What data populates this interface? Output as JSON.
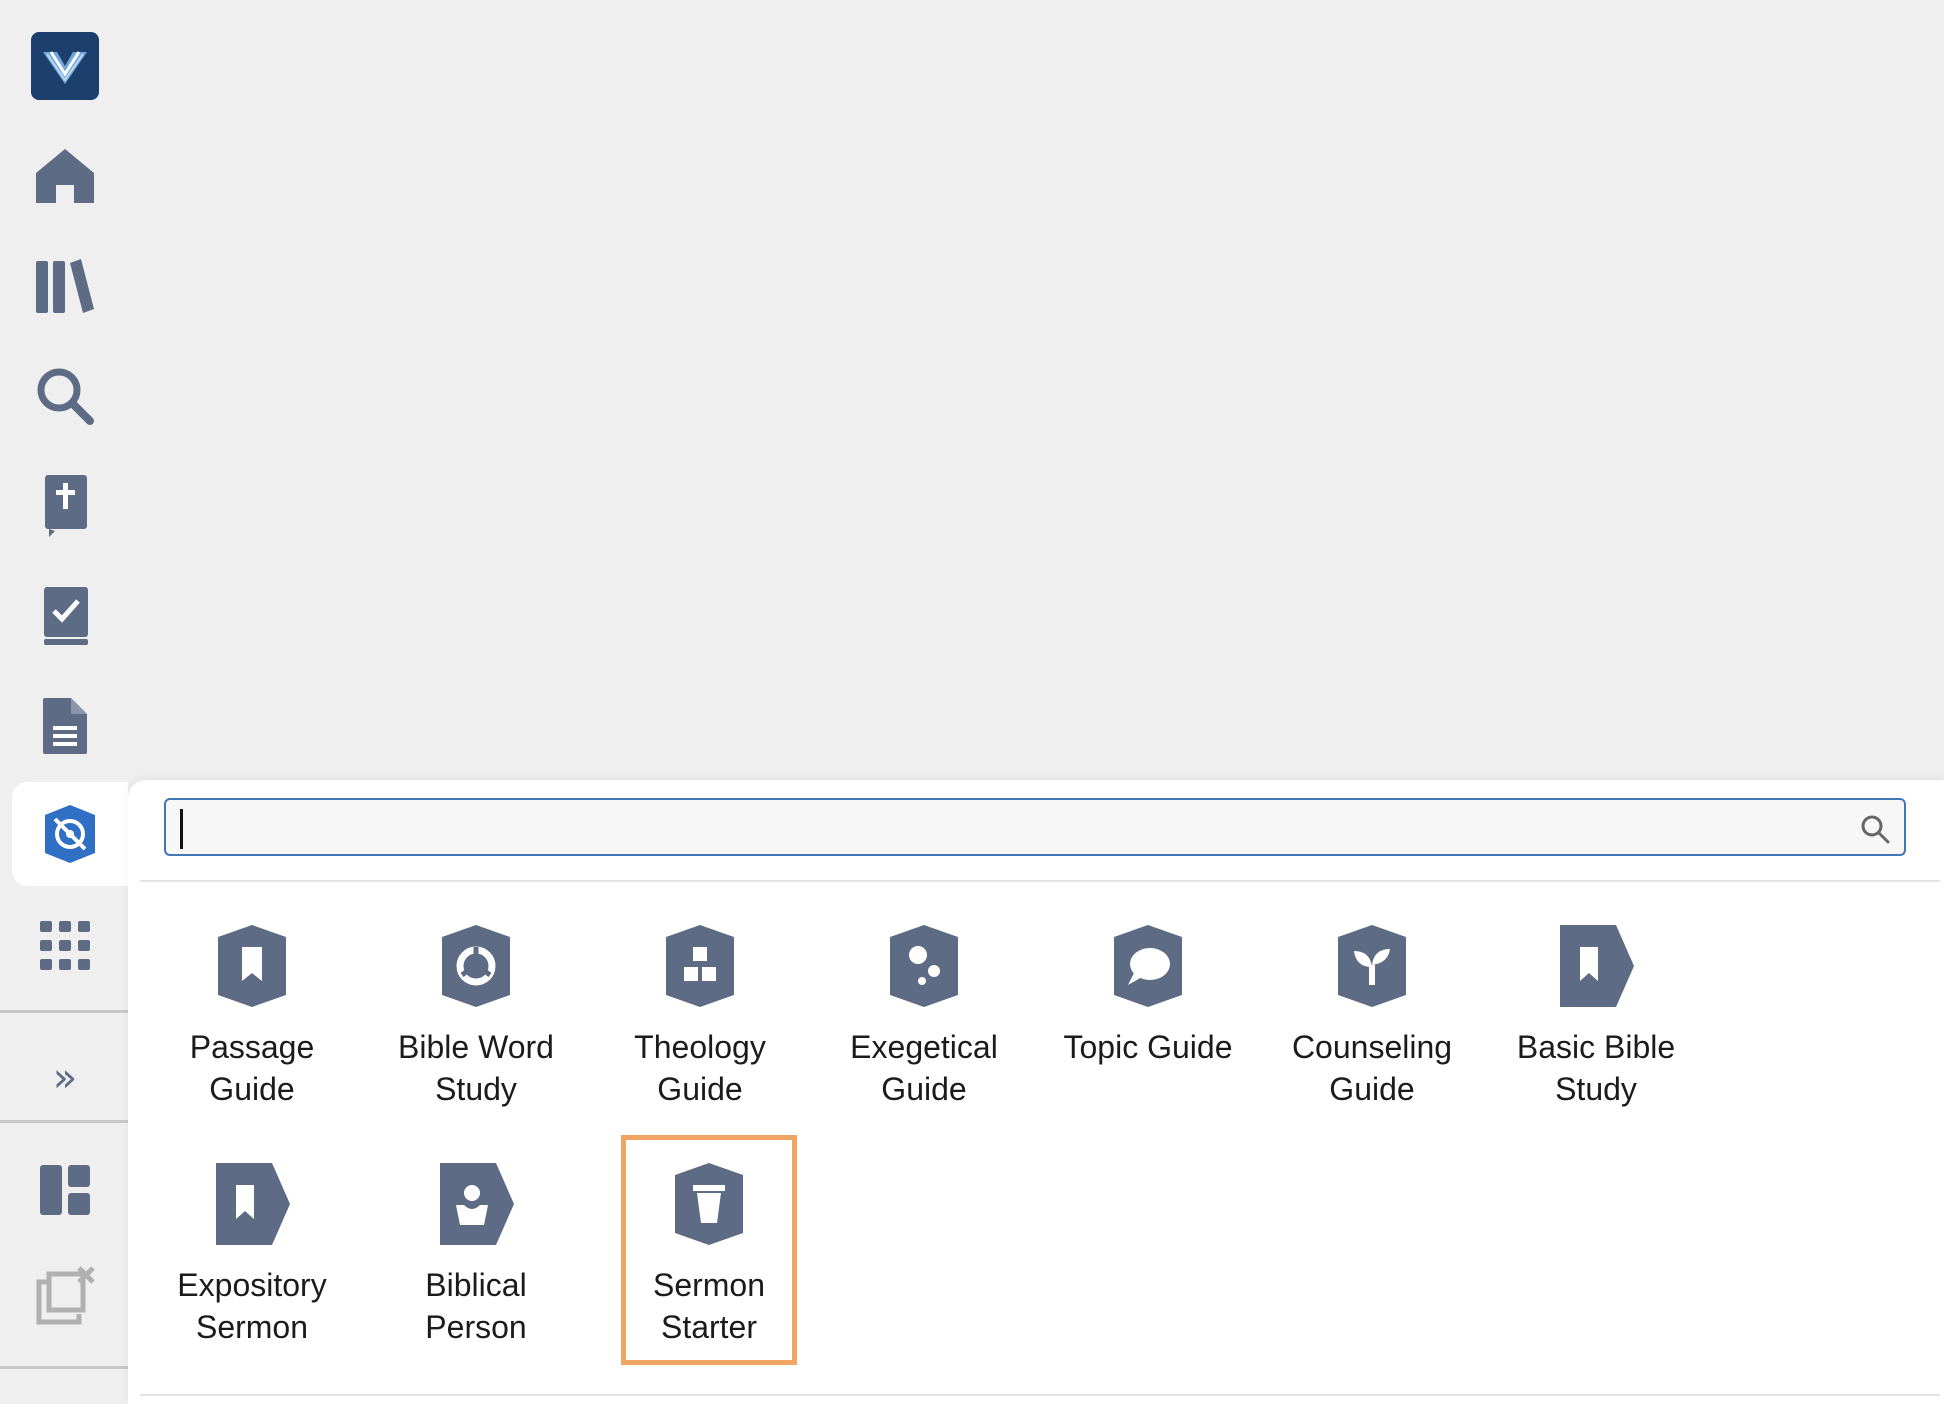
{
  "sidebar": {
    "items": [
      {
        "name": "app-logo",
        "icon": "logo-icon"
      },
      {
        "name": "home",
        "icon": "home-icon"
      },
      {
        "name": "library",
        "icon": "library-icon"
      },
      {
        "name": "search",
        "icon": "search-icon"
      },
      {
        "name": "bible",
        "icon": "bible-icon"
      },
      {
        "name": "reading-plan",
        "icon": "checkbook-icon"
      },
      {
        "name": "documents",
        "icon": "document-icon"
      },
      {
        "name": "guides",
        "icon": "guides-icon",
        "active": true
      },
      {
        "name": "apps",
        "icon": "grid-icon"
      },
      {
        "name": "expand",
        "icon": "double-chevron-right-icon",
        "label": "»"
      },
      {
        "name": "layouts",
        "icon": "layout-icon"
      },
      {
        "name": "close-panels",
        "icon": "close-windows-icon"
      }
    ],
    "icon_color": "#5e6b85",
    "active_color": "#2f6fc4"
  },
  "search": {
    "placeholder": "",
    "value": ""
  },
  "guides": [
    {
      "label": "Passage\nGuide",
      "icon": "bookmark-hex-icon"
    },
    {
      "label": "Bible Word\nStudy",
      "icon": "word-study-hex-icon"
    },
    {
      "label": "Theology\nGuide",
      "icon": "blocks-hex-icon"
    },
    {
      "label": "Exegetical\nGuide",
      "icon": "dots-hex-icon"
    },
    {
      "label": "Topic Guide",
      "icon": "speech-bubble-hex-icon"
    },
    {
      "label": "Counseling\nGuide",
      "icon": "sprout-hex-icon"
    },
    {
      "label": "Basic Bible\nStudy",
      "icon": "bookmark-tag-icon"
    },
    {
      "label": "Expository\nSermon",
      "icon": "bookmark-tag-icon"
    },
    {
      "label": "Biblical\nPerson",
      "icon": "person-tag-icon"
    },
    {
      "label": "Sermon\nStarter",
      "icon": "cup-hex-icon",
      "selected": true
    }
  ],
  "colors": {
    "highlight": "#f2a462",
    "search_border": "#3f78b4",
    "icon": "#5e6b85"
  }
}
